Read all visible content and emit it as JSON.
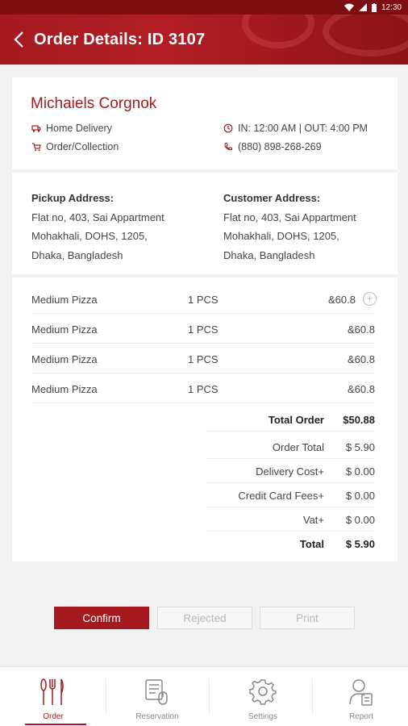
{
  "status_bar": {
    "time": "12:30"
  },
  "header": {
    "title": "Order Details: ID 3107"
  },
  "customer": {
    "name": "Michaiels Corgnok",
    "delivery_type": "Home Delivery",
    "order_type": "Order/Collection",
    "time_info": "IN: 12:00 AM | OUT: 4:00 PM",
    "phone": "(880) 898-268-269"
  },
  "addresses": {
    "pickup": {
      "heading": "Pickup Address:",
      "lines": [
        "Flat no, 403, Sai Appartment",
        "Mohakhali, DOHS, 1205,",
        "Dhaka, Bangladesh"
      ]
    },
    "customer": {
      "heading": "Customer Address:",
      "lines": [
        "Flat no, 403, Sai Appartment",
        "Mohakhali, DOHS, 1205,",
        "Dhaka, Bangladesh"
      ]
    }
  },
  "items": [
    {
      "name": "Medium Pizza",
      "qty": "1 PCS",
      "price": "&60.8"
    },
    {
      "name": "Medium Pizza",
      "qty": "1 PCS",
      "price": "&60.8"
    },
    {
      "name": "Medium Pizza",
      "qty": "1 PCS",
      "price": "&60.8"
    },
    {
      "name": "Medium Pizza",
      "qty": "1 PCS",
      "price": "&60.8"
    }
  ],
  "add_symbol": "+",
  "summary": {
    "total_order": {
      "label": "Total Order",
      "value": "$50.88"
    },
    "order_total": {
      "label": "Order Total",
      "value": "$ 5.90"
    },
    "delivery_cost": {
      "label": "Delivery Cost+",
      "value": "$ 0.00"
    },
    "card_fees": {
      "label": "Credit Card Fees+",
      "value": "$ 0.00"
    },
    "vat": {
      "label": "Vat+",
      "value": "$ 0.00"
    },
    "total": {
      "label": "Total",
      "value": "$ 5.90"
    }
  },
  "buttons": {
    "confirm": "Confirm",
    "rejected": "Rejected",
    "print": "Print"
  },
  "nav": [
    {
      "label": "Order",
      "icon": "cutlery-icon",
      "active": true
    },
    {
      "label": "Reservation",
      "icon": "reservation-icon",
      "active": false
    },
    {
      "label": "Settings",
      "icon": "gear-icon",
      "active": false
    },
    {
      "label": "Report",
      "icon": "report-icon",
      "active": false
    }
  ],
  "colors": {
    "brand": "#a51a1f",
    "brand_dark": "#7d0f12",
    "background": "#f2f2f2"
  }
}
